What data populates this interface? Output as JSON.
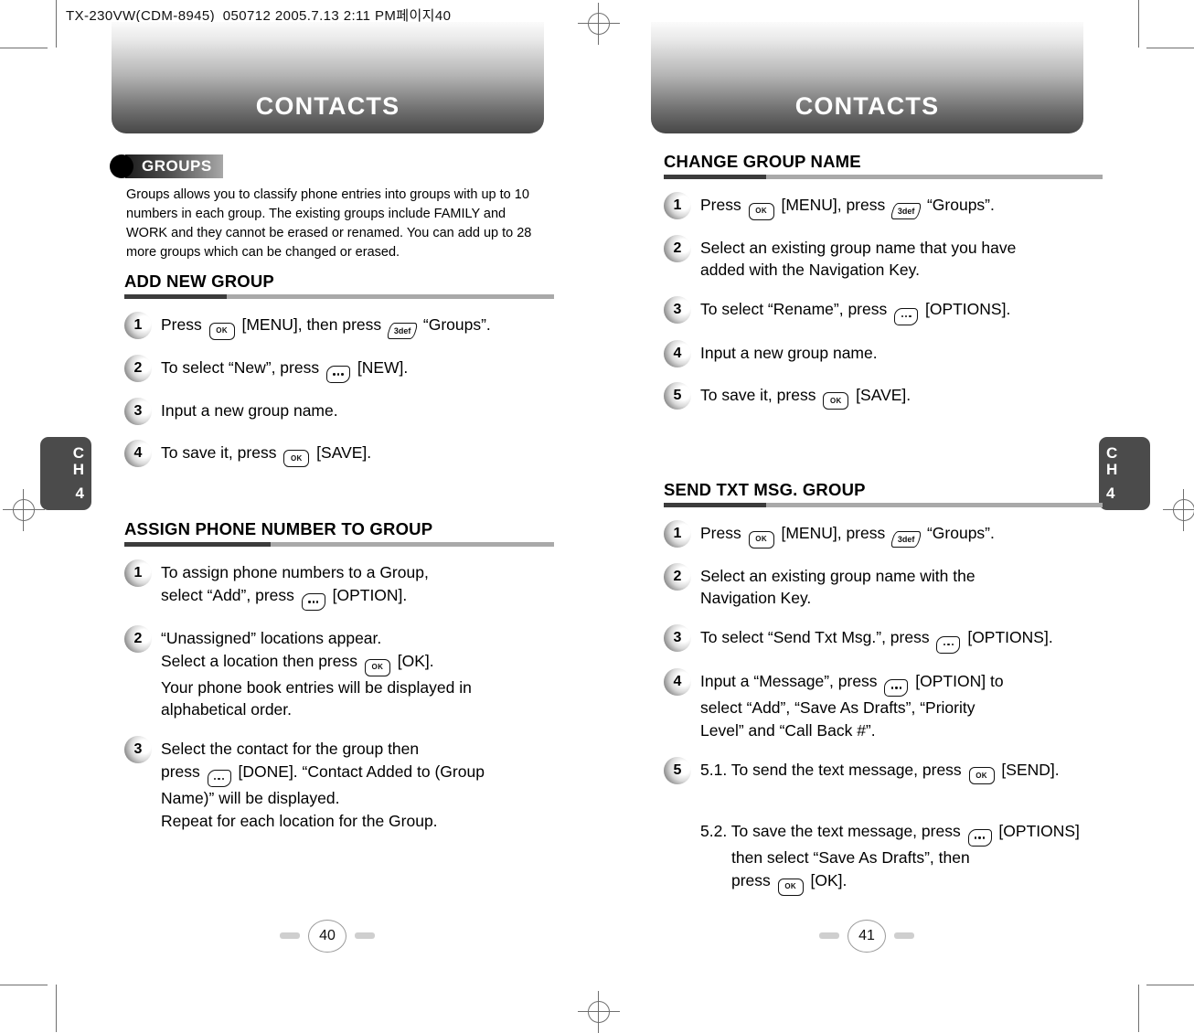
{
  "file_header": "TX-230VW(CDM-8945)_050712  2005.7.13 2:11 PM페이지40",
  "chapter_tab": {
    "c": "C",
    "h": "H",
    "number": "4"
  },
  "left_page": {
    "banner_title": "CONTACTS",
    "badge_label": "GROUPS",
    "intro": "Groups allows you to classify phone entries into groups with up to 10 numbers in each group.  The existing groups include FAMILY and WORK and they cannot be erased or renamed.  You can add up to 28 more groups which can be changed or erased.",
    "page_number": "40",
    "sections": [
      {
        "heading": "ADD NEW GROUP",
        "steps": [
          {
            "number": "1",
            "lines": [
              [
                {
                  "t": "text",
                  "v": "Press "
                },
                {
                  "t": "key",
                  "v": "ok"
                },
                {
                  "t": "text",
                  "v": " [MENU], then press "
                },
                {
                  "t": "key",
                  "v": "3def"
                },
                {
                  "t": "text",
                  "v": " “Groups”."
                }
              ]
            ]
          },
          {
            "number": "2",
            "lines": [
              [
                {
                  "t": "text",
                  "v": "To select “New”, press "
                },
                {
                  "t": "key",
                  "v": "soft"
                },
                {
                  "t": "text",
                  "v": " [NEW]."
                }
              ]
            ]
          },
          {
            "number": "3",
            "lines": [
              [
                {
                  "t": "text",
                  "v": "Input a new group name."
                }
              ]
            ]
          },
          {
            "number": "4",
            "lines": [
              [
                {
                  "t": "text",
                  "v": "To save it, press "
                },
                {
                  "t": "key",
                  "v": "ok"
                },
                {
                  "t": "text",
                  "v": " [SAVE]."
                }
              ]
            ]
          }
        ]
      },
      {
        "heading": "ASSIGN PHONE NUMBER TO GROUP",
        "steps": [
          {
            "number": "1",
            "lines": [
              [
                {
                  "t": "text",
                  "v": "To assign phone numbers to a Group,"
                }
              ],
              [
                {
                  "t": "text",
                  "v": "select “Add”, press "
                },
                {
                  "t": "key",
                  "v": "soft"
                },
                {
                  "t": "text",
                  "v": " [OPTION]."
                }
              ]
            ]
          },
          {
            "number": "2",
            "lines": [
              [
                {
                  "t": "text",
                  "v": "“Unassigned” locations appear."
                }
              ],
              [
                {
                  "t": "text",
                  "v": "Select a location then press "
                },
                {
                  "t": "key",
                  "v": "ok"
                },
                {
                  "t": "text",
                  "v": " [OK]."
                }
              ],
              [
                {
                  "t": "text",
                  "v": "Your phone book entries will be displayed in"
                }
              ],
              [
                {
                  "t": "text",
                  "v": "alphabetical order."
                }
              ]
            ]
          },
          {
            "number": "3",
            "lines": [
              [
                {
                  "t": "text",
                  "v": "Select the contact for the group then"
                }
              ],
              [
                {
                  "t": "text",
                  "v": "press "
                },
                {
                  "t": "key",
                  "v": "soft"
                },
                {
                  "t": "text",
                  "v": " [DONE]. “Contact Added to (Group"
                }
              ],
              [
                {
                  "t": "text",
                  "v": "Name)” will be displayed."
                }
              ],
              [
                {
                  "t": "text",
                  "v": "Repeat for each location for the Group."
                }
              ]
            ]
          }
        ]
      }
    ]
  },
  "right_page": {
    "banner_title": "CONTACTS",
    "page_number": "41",
    "sections": [
      {
        "heading": "CHANGE GROUP NAME",
        "steps": [
          {
            "number": "1",
            "lines": [
              [
                {
                  "t": "text",
                  "v": "Press "
                },
                {
                  "t": "key",
                  "v": "ok"
                },
                {
                  "t": "text",
                  "v": " [MENU], press "
                },
                {
                  "t": "key",
                  "v": "3def"
                },
                {
                  "t": "text",
                  "v": " “Groups”."
                }
              ]
            ]
          },
          {
            "number": "2",
            "lines": [
              [
                {
                  "t": "text",
                  "v": "Select an existing group name that you have"
                }
              ],
              [
                {
                  "t": "text",
                  "v": "added with the Navigation Key."
                }
              ]
            ]
          },
          {
            "number": "3",
            "lines": [
              [
                {
                  "t": "text",
                  "v": "To select “Rename”, press "
                },
                {
                  "t": "key",
                  "v": "soft"
                },
                {
                  "t": "text",
                  "v": " [OPTIONS]."
                }
              ]
            ]
          },
          {
            "number": "4",
            "lines": [
              [
                {
                  "t": "text",
                  "v": "Input a new group name."
                }
              ]
            ]
          },
          {
            "number": "5",
            "lines": [
              [
                {
                  "t": "text",
                  "v": "To save it, press "
                },
                {
                  "t": "key",
                  "v": "ok"
                },
                {
                  "t": "text",
                  "v": " [SAVE]."
                }
              ]
            ]
          }
        ]
      },
      {
        "heading": "SEND TXT MSG. GROUP",
        "steps": [
          {
            "number": "1",
            "lines": [
              [
                {
                  "t": "text",
                  "v": "Press "
                },
                {
                  "t": "key",
                  "v": "ok"
                },
                {
                  "t": "text",
                  "v": " [MENU], press "
                },
                {
                  "t": "key",
                  "v": "3def"
                },
                {
                  "t": "text",
                  "v": " “Groups”."
                }
              ]
            ]
          },
          {
            "number": "2",
            "lines": [
              [
                {
                  "t": "text",
                  "v": "Select an existing group name with the"
                }
              ],
              [
                {
                  "t": "text",
                  "v": "Navigation Key."
                }
              ]
            ]
          },
          {
            "number": "3",
            "lines": [
              [
                {
                  "t": "text",
                  "v": "To select “Send Txt Msg.”, press "
                },
                {
                  "t": "key",
                  "v": "soft"
                },
                {
                  "t": "text",
                  "v": " [OPTIONS]."
                }
              ]
            ]
          },
          {
            "number": "4",
            "lines": [
              [
                {
                  "t": "text",
                  "v": "Input a “Message”, press "
                },
                {
                  "t": "key",
                  "v": "soft"
                },
                {
                  "t": "text",
                  "v": " [OPTION] to"
                }
              ],
              [
                {
                  "t": "text",
                  "v": "select “Add”, “Save As Drafts”, “Priority"
                }
              ],
              [
                {
                  "t": "text",
                  "v": "Level” and “Call Back #”."
                }
              ]
            ]
          },
          {
            "number": "5",
            "lines": [
              [
                {
                  "t": "text",
                  "v": "5.1. To send the text message, press "
                },
                {
                  "t": "key",
                  "v": "ok"
                },
                {
                  "t": "text",
                  "v": " [SEND]."
                }
              ],
              [
                {
                  "t": "gap"
                }
              ],
              [
                {
                  "t": "text",
                  "v": "5.2. To save the text message, press "
                },
                {
                  "t": "key",
                  "v": "soft"
                },
                {
                  "t": "text",
                  "v": " [OPTIONS]"
                }
              ],
              [
                {
                  "t": "indent",
                  "v": "then select “Save As Drafts”, then"
                }
              ],
              [
                {
                  "t": "indent2",
                  "v": "press "
                },
                {
                  "t": "key",
                  "v": "ok"
                },
                {
                  "t": "text",
                  "v": " [OK]."
                }
              ]
            ]
          }
        ]
      }
    ]
  }
}
